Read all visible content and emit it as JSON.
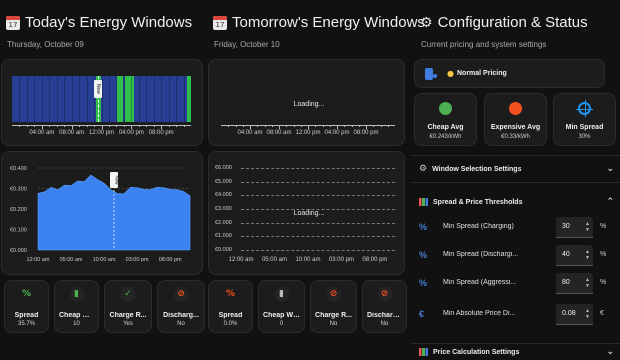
{
  "today": {
    "title": "Today's Energy Windows",
    "date": "Thursday, October 09",
    "timeline_labels": [
      "04:00 am",
      "08:00 am",
      "12:00 pm",
      "04:00 pm",
      "08:00 pm"
    ],
    "now_label": "Now",
    "price_chart": {
      "y_ticks": [
        "€0.400",
        "€0.300",
        "€0.200",
        "€0.100",
        "€0.000"
      ],
      "x_ticks": [
        "12:00 am",
        "05:00 am",
        "10:00 am",
        "03:00 pm",
        "08:00 pm"
      ],
      "now_label": "Now"
    },
    "tiles": [
      {
        "icon": "%",
        "icon_name": "percent-icon",
        "name": "Spread",
        "value": "35.7%",
        "color": "#4caf50"
      },
      {
        "icon": "▮",
        "icon_name": "battery-icon",
        "name": "Cheap Wi...",
        "value": "10",
        "color": "#4caf50"
      },
      {
        "icon": "✓",
        "icon_name": "check-circle-icon",
        "name": "Charge R...",
        "value": "Yes",
        "color": "#4caf50"
      },
      {
        "icon": "⊘",
        "icon_name": "block-icon",
        "name": "Discharg...",
        "value": "No",
        "color": "#f4511e"
      }
    ]
  },
  "tomorrow": {
    "title": "Tomorrow's Energy Windows",
    "date": "Friday, October 10",
    "loading": "Loading...",
    "timeline_labels": [
      "04:00 am",
      "08:00 am",
      "12:00 pm",
      "04:00 pm",
      "08:00 pm"
    ],
    "price_chart": {
      "y_ticks": [
        "€6.000",
        "€5.000",
        "€4.000",
        "€3.000",
        "€2.000",
        "€1.000",
        "€0.000"
      ],
      "x_ticks": [
        "12:00 am",
        "05:00 am",
        "10:00 am",
        "03:00 pm",
        "08:00 pm"
      ],
      "loading": "Loading..."
    },
    "tiles": [
      {
        "icon": "%",
        "icon_name": "percent-icon",
        "name": "Spread",
        "value": "0.0%",
        "color": "#f4511e"
      },
      {
        "icon": "▮",
        "icon_name": "battery-icon",
        "name": "Cheap Wi...",
        "value": "0",
        "color": "#bdbdbd"
      },
      {
        "icon": "⊘",
        "icon_name": "block-icon",
        "name": "Charge R...",
        "value": "No",
        "color": "#f4511e"
      },
      {
        "icon": "⊘",
        "icon_name": "block-icon",
        "name": "Discharg...",
        "value": "No",
        "color": "#f4511e"
      }
    ]
  },
  "config": {
    "title": "Configuration & Status",
    "subtitle": "Current pricing and system settings",
    "mode": {
      "label": "Normal Pricing"
    },
    "tiles": [
      {
        "name": "Cheap Avg",
        "value": "€0.243/kWh",
        "color": "#4caf50",
        "icon_name": "cheap-avg-icon"
      },
      {
        "name": "Expensive Avg",
        "value": "€0.33/kWh",
        "color": "#f4511e",
        "icon_name": "expensive-avg-icon"
      },
      {
        "name": "Min Spread",
        "value": "30%",
        "color": "#2196f3",
        "icon_name": "crosshair-icon"
      }
    ],
    "window_selection": {
      "label": "Window Selection Settings"
    },
    "spread_thresholds": {
      "label": "Spread & Price Thresholds"
    },
    "params": [
      {
        "label": "Min Spread (Charging)",
        "value": "30",
        "unit": "%",
        "icon": "%"
      },
      {
        "label": "Min Spread (Dischargi...",
        "value": "40",
        "unit": "%",
        "icon": "%"
      },
      {
        "label": "Min Spread (Aggressi...",
        "value": "80",
        "unit": "%",
        "icon": "%"
      },
      {
        "label": "Min Absolute Price Di...",
        "value": "0.08",
        "unit": "€",
        "icon": "€"
      }
    ],
    "price_calc": {
      "label": "Price Calculation Settings"
    }
  },
  "chart_data": {
    "type": "area",
    "title": "",
    "xlabel": "",
    "ylabel": "",
    "ylim": [
      0,
      0.4
    ],
    "x": [
      "12:00 am",
      "01:00 am",
      "02:00 am",
      "03:00 am",
      "04:00 am",
      "05:00 am",
      "06:00 am",
      "07:00 am",
      "08:00 am",
      "09:00 am",
      "10:00 am",
      "11:00 am",
      "12:00 pm",
      "01:00 pm",
      "02:00 pm",
      "03:00 pm",
      "04:00 pm",
      "05:00 pm",
      "06:00 pm",
      "07:00 pm",
      "08:00 pm",
      "09:00 pm",
      "10:00 pm",
      "11:00 pm"
    ],
    "series": [
      {
        "values": [
          0.27,
          0.29,
          0.3,
          0.3,
          0.31,
          0.32,
          0.33,
          0.34,
          0.36,
          0.35,
          0.32,
          0.3,
          0.27,
          0.28,
          0.3,
          0.31,
          0.29,
          0.3,
          0.3,
          0.31,
          0.29,
          0.3,
          0.28,
          0.27
        ]
      }
    ],
    "timeline_windows": [
      {
        "start_hour": 11.2,
        "end_hour": 12.0,
        "kind": "cheap"
      },
      {
        "start_hour": 14.1,
        "end_hour": 14.9,
        "kind": "cheap"
      },
      {
        "start_hour": 15.2,
        "end_hour": 16.4,
        "kind": "cheap"
      },
      {
        "start_hour": 23.5,
        "end_hour": 24.0,
        "kind": "cheap"
      }
    ],
    "now_hour": 11.5
  }
}
